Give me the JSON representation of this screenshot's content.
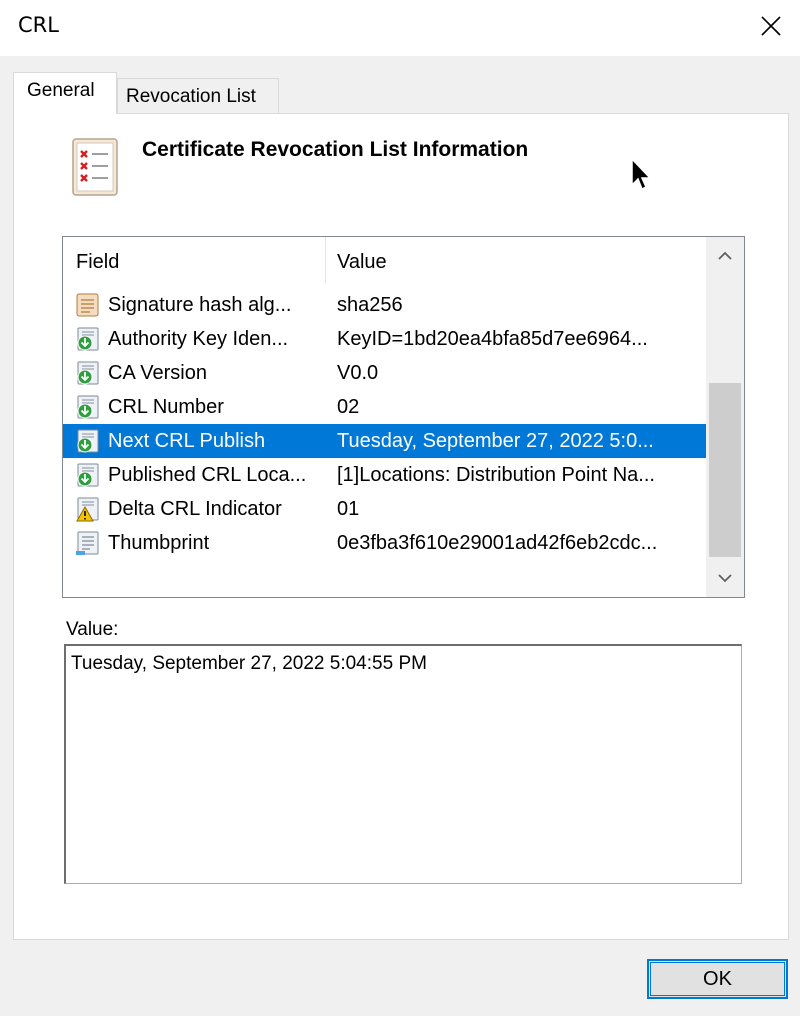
{
  "window": {
    "title": "CRL"
  },
  "tabs": [
    {
      "label": "General",
      "active": true
    },
    {
      "label": "Revocation List",
      "active": false
    }
  ],
  "general": {
    "heading": "Certificate Revocation List Information",
    "icon": "crl-info-icon",
    "list": {
      "columns": [
        "Field",
        "Value"
      ],
      "rows": [
        {
          "field": "Signature hash alg...",
          "value": "sha256",
          "icon": "field-properties-icon"
        },
        {
          "field": "Authority Key Iden...",
          "value": "KeyID=1bd20ea4bfa85d7ee6964...",
          "icon": "field-extension-icon"
        },
        {
          "field": "CA Version",
          "value": "V0.0",
          "icon": "field-extension-icon"
        },
        {
          "field": "CRL Number",
          "value": "02",
          "icon": "field-extension-icon"
        },
        {
          "field": "Next CRL Publish",
          "value": "Tuesday, September 27, 2022 5:0...",
          "icon": "field-extension-icon",
          "selected": true
        },
        {
          "field": "Published CRL Loca...",
          "value": "[1]Locations: Distribution Point Na...",
          "icon": "field-extension-icon"
        },
        {
          "field": "Delta CRL Indicator",
          "value": "01",
          "icon": "field-warning-icon"
        },
        {
          "field": "Thumbprint",
          "value": "0e3fba3f610e29001ad42f6eb2cdc...",
          "icon": "field-thumbprint-icon"
        }
      ]
    },
    "value_label": "Value:",
    "value_text": "Tuesday, September 27, 2022 5:04:55 PM"
  },
  "buttons": {
    "ok": "OK"
  },
  "colors": {
    "selection": "#0078d7",
    "dialog_bg": "#f0f0f0"
  }
}
